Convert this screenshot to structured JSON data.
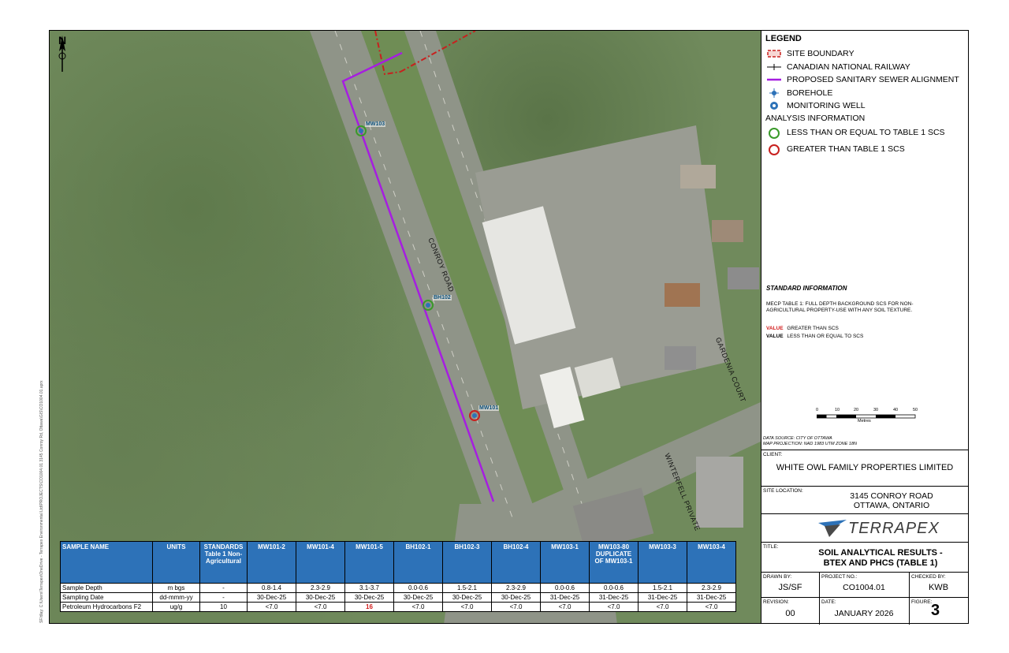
{
  "sidebar_path": "SF/dlay: C:\\Users\\Terrapex\\OneDrive - Terrapex Environmental Ltd\\PROJECTS\\CO1004.01 3145 Conroy Rd, Ottawa\\GIS\\CO1004.01.aprx",
  "map": {
    "north_label": "N",
    "road_labels": {
      "conroy": "CONROY ROAD",
      "gardenia": "GARDENIA COURT",
      "winterfell": "WINTERFELL PRIVATE"
    },
    "wells": [
      {
        "id": "MW103",
        "status": "less-equal"
      },
      {
        "id": "BH102",
        "status": "less-equal"
      },
      {
        "id": "MW101",
        "status": "greater"
      }
    ]
  },
  "legend": {
    "title": "LEGEND",
    "items": [
      {
        "label": "SITE BOUNDARY",
        "icon": "site-boundary"
      },
      {
        "label": "CANADIAN NATIONAL RAILWAY",
        "icon": "railway"
      },
      {
        "label": "PROPOSED SANITARY SEWER ALIGNMENT",
        "icon": "sewer-line"
      },
      {
        "label": "BOREHOLE",
        "icon": "borehole"
      },
      {
        "label": "MONITORING WELL",
        "icon": "monitoring-well"
      }
    ],
    "analysis_title": "ANALYSIS INFORMATION",
    "analysis": [
      {
        "label": "LESS THAN OR EQUAL TO TABLE 1 SCS",
        "color": "#3a9a2a"
      },
      {
        "label": "GREATER THAN TABLE 1 SCS",
        "color": "#c8201e"
      }
    ]
  },
  "standard_info": {
    "title": "STANDARD INFORMATION",
    "text": "MECP TABLE 1: FULL DEPTH BACKGROUND SCS FOR NON-AGRICULTURAL PROPERTY-USE WITH ANY SOIL TEXTURE.",
    "value_word": "VALUE",
    "greater": "GREATER THAN SCS",
    "less_equal": "LESS THAN OR EQUAL TO SCS"
  },
  "scale": {
    "ticks": [
      "0",
      "10",
      "20",
      "30",
      "40",
      "50"
    ],
    "unit": "Metres"
  },
  "data_source": "DATA SOURCE: CITY OF OTTAWA",
  "map_projection": "MAP PROJECTION: NAD 1983 UTM ZONE 18N",
  "client": {
    "label": "CLIENT:",
    "name": "WHITE OWL FAMILY PROPERTIES LIMITED"
  },
  "site": {
    "label": "SITE LOCATION:",
    "line1": "3145 CONROY ROAD",
    "line2": "OTTAWA, ONTARIO"
  },
  "logo": "TERRAPEX",
  "title": {
    "label": "TITLE:",
    "line1": "SOIL ANALYTICAL RESULTS -",
    "line2": "BTEX AND PHCS (TABLE 1)"
  },
  "drawn_by": {
    "label": "DRAWN BY:",
    "value": "JS/SF"
  },
  "project_no": {
    "label": "PROJECT NO.:",
    "value": "CO1004.01"
  },
  "checked_by": {
    "label": "CHECKED BY:",
    "value": "KWB"
  },
  "revision": {
    "label": "REVISION:",
    "value": "00"
  },
  "date": {
    "label": "DATE:",
    "value": "JANUARY 2026"
  },
  "figure": {
    "label": "FIGURE:",
    "value": "3"
  },
  "table": {
    "headers": [
      "SAMPLE NAME",
      "UNITS",
      "STANDARDS Table 1 Non-Agricultural",
      "MW101-2",
      "MW101-4",
      "MW101-5",
      "BH102-1",
      "BH102-3",
      "BH102-4",
      "MW103-1",
      "MW103-80 DUPLICATE OF MW103-1",
      "MW103-3",
      "MW103-4"
    ],
    "rows": [
      [
        "Sample Depth",
        "m bgs",
        "-",
        "0.8-1.4",
        "2.3-2.9",
        "3.1-3.7",
        "0.0-0.6",
        "1.5-2.1",
        "2.3-2.9",
        "0.0-0.6",
        "0.0-0.6",
        "1.5-2.1",
        "2.3-2.9"
      ],
      [
        "Sampling Date",
        "dd-mmm-yy",
        "-",
        "30-Dec-25",
        "30-Dec-25",
        "30-Dec-25",
        "30-Dec-25",
        "30-Dec-25",
        "30-Dec-25",
        "31-Dec-25",
        "31-Dec-25",
        "31-Dec-25",
        "31-Dec-25"
      ],
      [
        "Petroleum Hydrocarbons F2",
        "ug/g",
        "10",
        "<7.0",
        "<7.0",
        "16",
        "<7.0",
        "<7.0",
        "<7.0",
        "<7.0",
        "<7.0",
        "<7.0",
        "<7.0"
      ]
    ]
  }
}
